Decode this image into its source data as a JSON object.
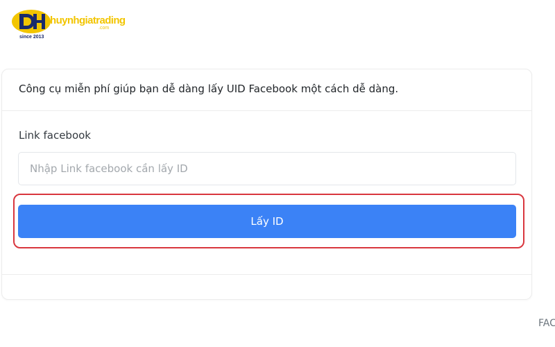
{
  "logo": {
    "name": "huynhgiatrading",
    "domain": ".com",
    "since": "since 2013",
    "colors": {
      "yellow": "#f2c500",
      "navy": "#1a2a6c"
    }
  },
  "card": {
    "title": "Công cụ miễn phí giúp bạn dễ dàng lấy UID Facebook một cách dễ dàng.",
    "field_label": "Link facebook",
    "input": {
      "value": "",
      "placeholder": "Nhập Link facebook cần lấy ID"
    },
    "button_label": "Lấy ID"
  },
  "edge_text": "FAC",
  "colors": {
    "button": "#3b82f6",
    "highlight": "#d9363e"
  }
}
